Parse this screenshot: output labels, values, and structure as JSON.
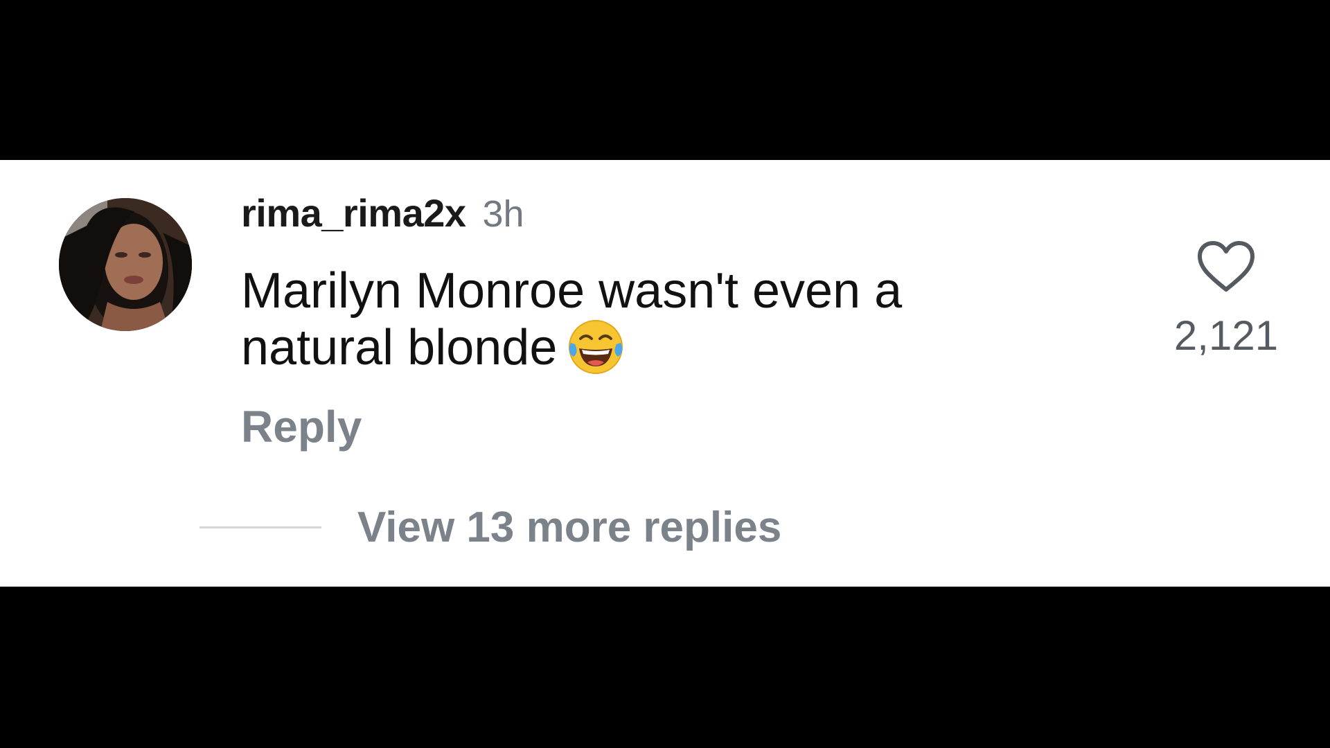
{
  "comment": {
    "username": "rima_rima2x",
    "timestamp": "3h",
    "text_line1": "Marilyn Monroe wasn't even a",
    "text_line2": "natural blonde",
    "emoji": "face-with-tears-of-joy",
    "reply_label": "Reply",
    "like_count": "2,121",
    "view_replies_label": "View 13 more replies"
  },
  "colors": {
    "background_band": "#000000",
    "card": "#ffffff",
    "username": "#1a1a1a",
    "muted_text": "#7b828a",
    "like_count": "#555b61"
  },
  "icons": {
    "like": "heart-outline-icon",
    "emoji": "laughing-tears-emoji-icon"
  }
}
